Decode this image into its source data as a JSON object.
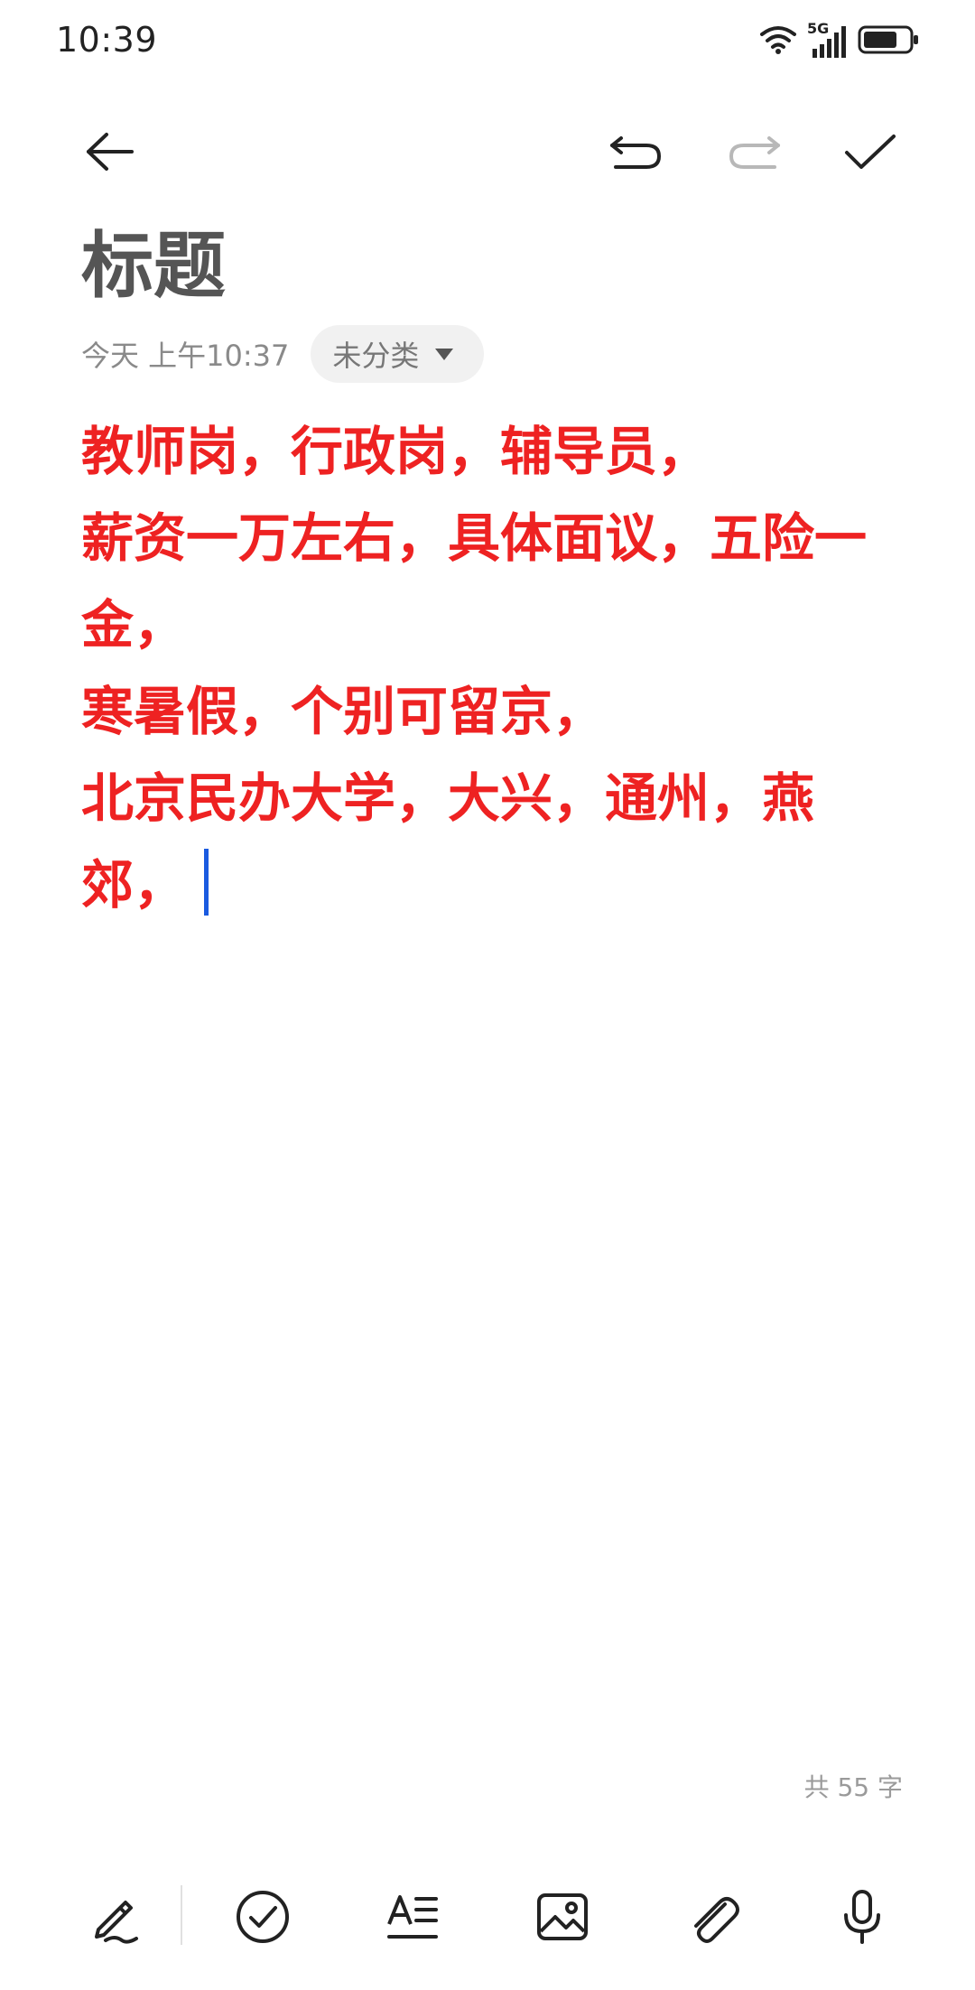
{
  "status_bar": {
    "time": "10:39",
    "network": "5G",
    "icons": [
      "wifi-icon",
      "signal-icon",
      "battery-icon"
    ]
  },
  "toolbar": {
    "icons": [
      "back-arrow-icon",
      "undo-icon",
      "redo-icon",
      "checkmark-icon"
    ]
  },
  "note": {
    "title": "标题",
    "date": "今天 上午10:37",
    "category": "未分类",
    "lines": [
      "教师岗，行政岗，辅导员，",
      "薪资一万左右，具体面议，五险一金，",
      "寒暑假，个别可留京，",
      "北京民办大学，大兴，通州，燕郊，"
    ],
    "word_count": "共 55 字"
  },
  "bottom_toolbar": {
    "icons": [
      "handwriting-icon",
      "checklist-icon",
      "text-format-icon",
      "image-icon",
      "attachment-icon",
      "microphone-icon"
    ]
  },
  "colors": {
    "body_text": "#ee2222",
    "title_text": "#555555",
    "cursor": "#1a5ae0",
    "chip_bg": "#f1f1f1"
  }
}
